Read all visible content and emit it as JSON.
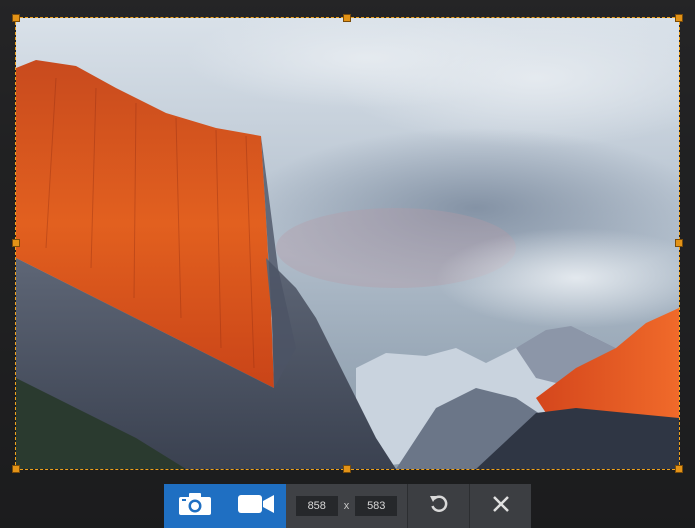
{
  "selection": {
    "width": "858",
    "height": "583",
    "separator": "x"
  },
  "toolbar": {
    "screenshot_button": "camera-icon",
    "record_button": "video-camera-icon",
    "reset_button": "rotate-icon",
    "close_button": "close-icon"
  },
  "colors": {
    "accent": "#1f6fc2",
    "selection_border": "#f0a21c"
  }
}
